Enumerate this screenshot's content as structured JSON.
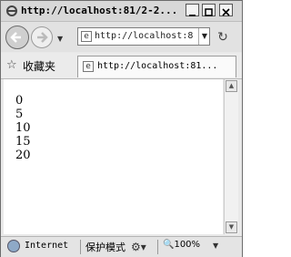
{
  "window": {
    "title": "http://localhost:81/2-2..."
  },
  "navigation": {
    "address": "http://localhost:8"
  },
  "favorites": {
    "label": "收藏夹"
  },
  "tab": {
    "title": "http://localhost:81..."
  },
  "content": {
    "lines": [
      "0",
      "5",
      "10",
      "15",
      "20"
    ]
  },
  "status": {
    "zone": "Internet",
    "protected_mode": "保护模式",
    "zoom": "100%"
  }
}
